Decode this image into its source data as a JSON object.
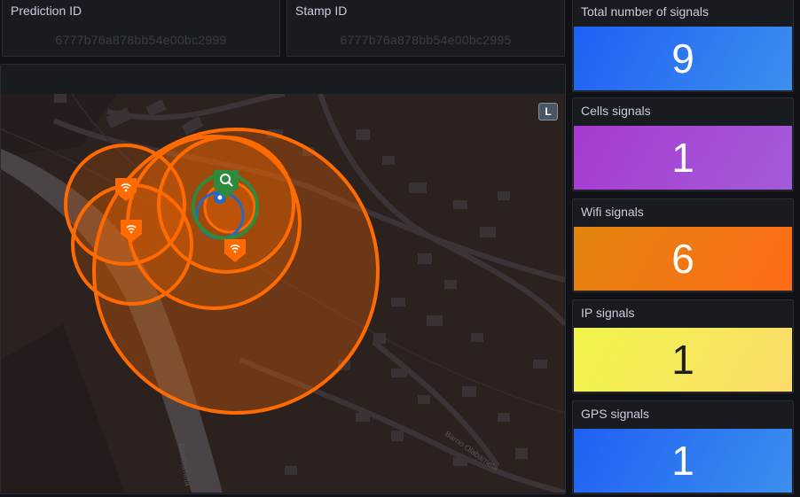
{
  "panels": {
    "prediction_id": {
      "title": "Prediction ID",
      "value": "6777b76a878bb54e00bc2999"
    },
    "stamp_id": {
      "title": "Stamp ID",
      "value": "6777b76a878bb54e00bc2995"
    }
  },
  "map": {
    "layer_button_label": "L",
    "street_labels": [
      "Barrio Olabarrieta",
      "Bidebarrieta"
    ]
  },
  "stats": [
    {
      "title": "Total number of signals",
      "value": "9",
      "colors": [
        "#1f60f4",
        "#3d8fee"
      ],
      "text_color": "#ffffff"
    },
    {
      "title": "Cells signals",
      "value": "1",
      "colors": [
        "#a83ad1",
        "#a35cd9"
      ],
      "text_color": "#ffffff"
    },
    {
      "title": "Wifi signals",
      "value": "6",
      "colors": [
        "#e1840d",
        "#ff6b17"
      ],
      "text_color": "#ffffff"
    },
    {
      "title": "IP signals",
      "value": "1",
      "colors": [
        "#f0f54a",
        "#fcdc6a"
      ],
      "text_color": "#1e1e1e"
    },
    {
      "title": "GPS signals",
      "value": "1",
      "colors": [
        "#1f60f4",
        "#3d8fee"
      ],
      "text_color": "#ffffff"
    }
  ],
  "colors": {
    "wifi": "#ff6b00",
    "cell_gps": "#2e8b3d",
    "ip_blue": "#2468c8"
  }
}
